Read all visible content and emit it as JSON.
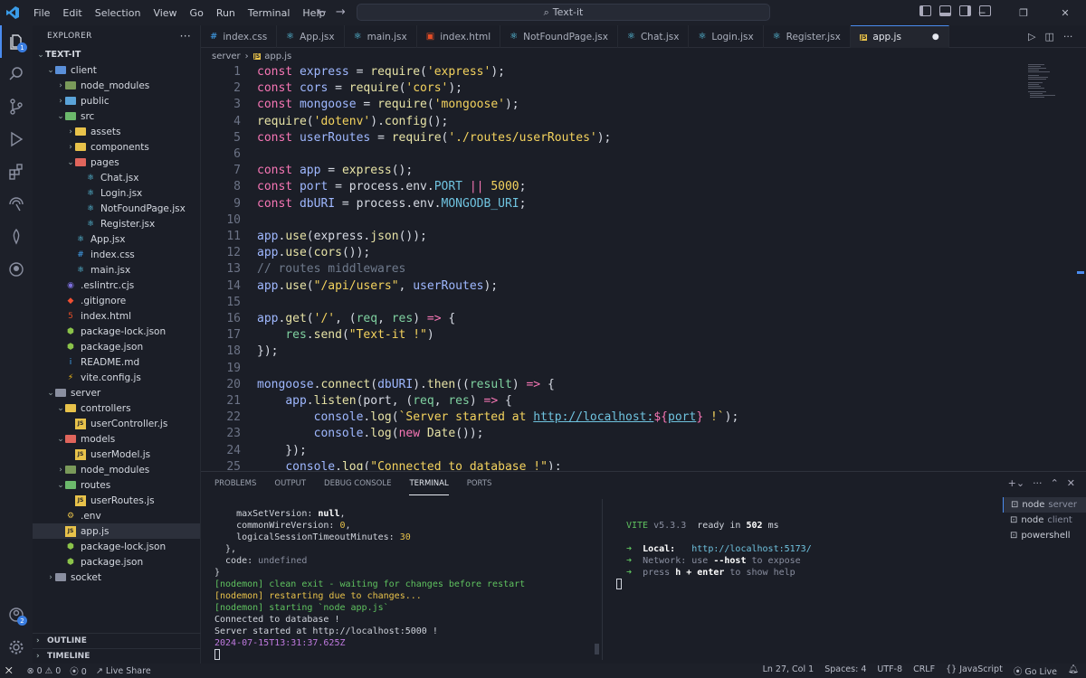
{
  "title_bar": {
    "menus": [
      "File",
      "Edit",
      "Selection",
      "View",
      "Go",
      "Run",
      "Terminal",
      "Help"
    ],
    "search": "Text-it"
  },
  "activity": {
    "explorer_badge": "1",
    "accounts_badge": "2"
  },
  "sidebar": {
    "header": "EXPLORER",
    "root": "TEXT-IT",
    "tree": [
      {
        "label": "client",
        "depth": 1,
        "type": "folder",
        "open": true,
        "color": "#5a8fd8"
      },
      {
        "label": "node_modules",
        "depth": 2,
        "type": "folder",
        "open": false,
        "color": "#7a9a5a"
      },
      {
        "label": "public",
        "depth": 2,
        "type": "folder",
        "open": false,
        "color": "#5aa3d8"
      },
      {
        "label": "src",
        "depth": 2,
        "type": "folder",
        "open": true,
        "color": "#6bb86b"
      },
      {
        "label": "assets",
        "depth": 3,
        "type": "folder",
        "open": false,
        "color": "#e8c24a"
      },
      {
        "label": "components",
        "depth": 3,
        "type": "folder",
        "open": false,
        "color": "#e8c24a"
      },
      {
        "label": "pages",
        "depth": 3,
        "type": "folder",
        "open": true,
        "color": "#e0655c"
      },
      {
        "label": "Chat.jsx",
        "depth": 4,
        "type": "react"
      },
      {
        "label": "Login.jsx",
        "depth": 4,
        "type": "react"
      },
      {
        "label": "NotFoundPage.jsx",
        "depth": 4,
        "type": "react"
      },
      {
        "label": "Register.jsx",
        "depth": 4,
        "type": "react"
      },
      {
        "label": "App.jsx",
        "depth": 3,
        "type": "react"
      },
      {
        "label": "index.css",
        "depth": 3,
        "type": "css"
      },
      {
        "label": "main.jsx",
        "depth": 3,
        "type": "react"
      },
      {
        "label": ".eslintrc.cjs",
        "depth": 2,
        "type": "eslint"
      },
      {
        "label": ".gitignore",
        "depth": 2,
        "type": "git"
      },
      {
        "label": "index.html",
        "depth": 2,
        "type": "html"
      },
      {
        "label": "package-lock.json",
        "depth": 2,
        "type": "npm"
      },
      {
        "label": "package.json",
        "depth": 2,
        "type": "npm"
      },
      {
        "label": "README.md",
        "depth": 2,
        "type": "info"
      },
      {
        "label": "vite.config.js",
        "depth": 2,
        "type": "vite"
      },
      {
        "label": "server",
        "depth": 1,
        "type": "folder",
        "open": true,
        "color": "#8a8fa0"
      },
      {
        "label": "controllers",
        "depth": 2,
        "type": "folder",
        "open": true,
        "color": "#e8c24a"
      },
      {
        "label": "userController.js",
        "depth": 3,
        "type": "js"
      },
      {
        "label": "models",
        "depth": 2,
        "type": "folder",
        "open": true,
        "color": "#e0655c"
      },
      {
        "label": "userModel.js",
        "depth": 3,
        "type": "js"
      },
      {
        "label": "node_modules",
        "depth": 2,
        "type": "folder",
        "open": false,
        "color": "#7a9a5a"
      },
      {
        "label": "routes",
        "depth": 2,
        "type": "folder",
        "open": true,
        "color": "#6bb86b"
      },
      {
        "label": "userRoutes.js",
        "depth": 3,
        "type": "js"
      },
      {
        "label": ".env",
        "depth": 2,
        "type": "env"
      },
      {
        "label": "app.js",
        "depth": 2,
        "type": "js",
        "selected": true
      },
      {
        "label": "package-lock.json",
        "depth": 2,
        "type": "npm"
      },
      {
        "label": "package.json",
        "depth": 2,
        "type": "npm"
      },
      {
        "label": "socket",
        "depth": 1,
        "type": "folder",
        "open": false,
        "color": "#8a8fa0"
      }
    ],
    "outline": "OUTLINE",
    "timeline": "TIMELINE"
  },
  "tabs": [
    {
      "label": "index.css",
      "type": "css"
    },
    {
      "label": "App.jsx",
      "type": "react"
    },
    {
      "label": "main.jsx",
      "type": "react"
    },
    {
      "label": "index.html",
      "type": "html"
    },
    {
      "label": "NotFoundPage.jsx",
      "type": "react"
    },
    {
      "label": "Chat.jsx",
      "type": "react"
    },
    {
      "label": "Login.jsx",
      "type": "react"
    },
    {
      "label": "Register.jsx",
      "type": "react"
    },
    {
      "label": "app.js",
      "type": "js",
      "active": true
    }
  ],
  "breadcrumb": {
    "folder": "server",
    "file": "app.js"
  },
  "code": [
    {
      "n": "1",
      "t": [
        [
          "k",
          "const "
        ],
        [
          "v",
          "express"
        ],
        [
          "p",
          " = "
        ],
        [
          "f",
          "require"
        ],
        [
          "p",
          "("
        ],
        [
          "s",
          "'express'"
        ],
        [
          "p",
          ");"
        ]
      ]
    },
    {
      "n": "2",
      "t": [
        [
          "k",
          "const "
        ],
        [
          "v",
          "cors"
        ],
        [
          "p",
          " = "
        ],
        [
          "f",
          "require"
        ],
        [
          "p",
          "("
        ],
        [
          "s",
          "'cors'"
        ],
        [
          "p",
          ");"
        ]
      ]
    },
    {
      "n": "3",
      "t": [
        [
          "k",
          "const "
        ],
        [
          "v",
          "mongoose"
        ],
        [
          "p",
          " = "
        ],
        [
          "f",
          "require"
        ],
        [
          "p",
          "("
        ],
        [
          "s",
          "'mongoose'"
        ],
        [
          "p",
          ");"
        ]
      ]
    },
    {
      "n": "4",
      "t": [
        [
          "f",
          "require"
        ],
        [
          "p",
          "("
        ],
        [
          "s",
          "'dotenv'"
        ],
        [
          "p",
          ")."
        ],
        [
          "f",
          "config"
        ],
        [
          "p",
          "();"
        ]
      ]
    },
    {
      "n": "5",
      "t": [
        [
          "k",
          "const "
        ],
        [
          "v",
          "userRoutes"
        ],
        [
          "p",
          " = "
        ],
        [
          "f",
          "require"
        ],
        [
          "p",
          "("
        ],
        [
          "s",
          "'./routes/userRoutes'"
        ],
        [
          "p",
          ");"
        ]
      ]
    },
    {
      "n": "6",
      "t": []
    },
    {
      "n": "7",
      "t": [
        [
          "k",
          "const "
        ],
        [
          "v",
          "app"
        ],
        [
          "p",
          " = "
        ],
        [
          "f",
          "express"
        ],
        [
          "p",
          "();"
        ]
      ]
    },
    {
      "n": "8",
      "t": [
        [
          "k",
          "const "
        ],
        [
          "v",
          "port"
        ],
        [
          "p",
          " = process.env."
        ],
        [
          "t",
          "PORT"
        ],
        [
          "p",
          " "
        ],
        [
          "o",
          "||"
        ],
        [
          "p",
          " "
        ],
        [
          "n",
          "5000"
        ],
        [
          "p",
          ";"
        ]
      ]
    },
    {
      "n": "9",
      "t": [
        [
          "k",
          "const "
        ],
        [
          "v",
          "dbURI"
        ],
        [
          "p",
          " = process.env."
        ],
        [
          "t",
          "MONGODB_URI"
        ],
        [
          "p",
          ";"
        ]
      ]
    },
    {
      "n": "10",
      "t": []
    },
    {
      "n": "11",
      "t": [
        [
          "v",
          "app"
        ],
        [
          "p",
          "."
        ],
        [
          "f",
          "use"
        ],
        [
          "p",
          "(express."
        ],
        [
          "f",
          "json"
        ],
        [
          "p",
          "());"
        ]
      ]
    },
    {
      "n": "12",
      "t": [
        [
          "v",
          "app"
        ],
        [
          "p",
          "."
        ],
        [
          "f",
          "use"
        ],
        [
          "p",
          "("
        ],
        [
          "f",
          "cors"
        ],
        [
          "p",
          "());"
        ]
      ]
    },
    {
      "n": "13",
      "t": [
        [
          "c",
          "// routes middlewares"
        ]
      ]
    },
    {
      "n": "14",
      "t": [
        [
          "v",
          "app"
        ],
        [
          "p",
          "."
        ],
        [
          "f",
          "use"
        ],
        [
          "p",
          "("
        ],
        [
          "s",
          "\"/api/users\""
        ],
        [
          "p",
          ", "
        ],
        [
          "v",
          "userRoutes"
        ],
        [
          "p",
          ");"
        ]
      ]
    },
    {
      "n": "15",
      "t": []
    },
    {
      "n": "16",
      "t": [
        [
          "v",
          "app"
        ],
        [
          "p",
          "."
        ],
        [
          "f",
          "get"
        ],
        [
          "p",
          "("
        ],
        [
          "s",
          "'/'"
        ],
        [
          "p",
          ", ("
        ],
        [
          "pp",
          "req"
        ],
        [
          "p",
          ", "
        ],
        [
          "pp",
          "res"
        ],
        [
          "p",
          ") "
        ],
        [
          "k",
          "=>"
        ],
        [
          "p",
          " {"
        ]
      ]
    },
    {
      "n": "17",
      "t": [
        [
          "p",
          "    "
        ],
        [
          "pp",
          "res"
        ],
        [
          "p",
          "."
        ],
        [
          "f",
          "send"
        ],
        [
          "p",
          "("
        ],
        [
          "s",
          "\"Text-it !\""
        ],
        [
          "p",
          ")"
        ]
      ]
    },
    {
      "n": "18",
      "t": [
        [
          "p",
          "});"
        ]
      ]
    },
    {
      "n": "19",
      "t": []
    },
    {
      "n": "20",
      "t": [
        [
          "v",
          "mongoose"
        ],
        [
          "p",
          "."
        ],
        [
          "f",
          "connect"
        ],
        [
          "p",
          "("
        ],
        [
          "v",
          "dbURI"
        ],
        [
          "p",
          ")."
        ],
        [
          "f",
          "then"
        ],
        [
          "p",
          "(("
        ],
        [
          "pp",
          "result"
        ],
        [
          "p",
          ") "
        ],
        [
          "k",
          "=>"
        ],
        [
          "p",
          " {"
        ]
      ]
    },
    {
      "n": "21",
      "t": [
        [
          "p",
          "    "
        ],
        [
          "v",
          "app"
        ],
        [
          "p",
          "."
        ],
        [
          "f",
          "listen"
        ],
        [
          "p",
          "(port, ("
        ],
        [
          "pp",
          "req"
        ],
        [
          "p",
          ", "
        ],
        [
          "pp",
          "res"
        ],
        [
          "p",
          ") "
        ],
        [
          "k",
          "=>"
        ],
        [
          "p",
          " {"
        ]
      ]
    },
    {
      "n": "22",
      "t": [
        [
          "p",
          "        "
        ],
        [
          "v",
          "console"
        ],
        [
          "p",
          "."
        ],
        [
          "f",
          "log"
        ],
        [
          "p",
          "("
        ],
        [
          "s",
          "`Server started at "
        ],
        [
          "u",
          "http://localhost:"
        ],
        [
          "k",
          "${"
        ],
        [
          "u",
          "port"
        ],
        [
          "k",
          "}"
        ],
        [
          "s",
          " !`"
        ],
        [
          "p",
          ");"
        ]
      ]
    },
    {
      "n": "23",
      "t": [
        [
          "p",
          "        "
        ],
        [
          "v",
          "console"
        ],
        [
          "p",
          "."
        ],
        [
          "f",
          "log"
        ],
        [
          "p",
          "("
        ],
        [
          "k",
          "new "
        ],
        [
          "f",
          "Date"
        ],
        [
          "p",
          "());"
        ]
      ]
    },
    {
      "n": "24",
      "t": [
        [
          "p",
          "    });"
        ]
      ]
    },
    {
      "n": "25",
      "t": [
        [
          "p",
          "    "
        ],
        [
          "v",
          "console"
        ],
        [
          "p",
          "."
        ],
        [
          "f",
          "log"
        ],
        [
          "p",
          "("
        ],
        [
          "s",
          "\"Connected to database !\""
        ],
        [
          "p",
          ");"
        ]
      ]
    }
  ],
  "panel": {
    "tabs": [
      "PROBLEMS",
      "OUTPUT",
      "DEBUG CONSOLE",
      "TERMINAL",
      "PORTS"
    ],
    "active_tab": "TERMINAL",
    "left_lines": [
      {
        "t": [
          [
            "p",
            "    maxSetVersion: "
          ],
          [
            "b",
            "null"
          ],
          [
            "p",
            ","
          ]
        ]
      },
      {
        "t": [
          [
            "p",
            "    commonWireVersion: "
          ],
          [
            "y",
            "0"
          ],
          [
            "p",
            ","
          ]
        ]
      },
      {
        "t": [
          [
            "p",
            "    logicalSessionTimeoutMinutes: "
          ],
          [
            "y",
            "30"
          ]
        ]
      },
      {
        "t": [
          [
            "p",
            "  },"
          ]
        ]
      },
      {
        "t": [
          [
            "p",
            "  code: "
          ],
          [
            "g",
            "undefined"
          ]
        ]
      },
      {
        "t": [
          [
            "p",
            "}"
          ]
        ]
      },
      {
        "t": [
          [
            "gr",
            "[nodemon] clean exit - waiting for changes before restart"
          ]
        ]
      },
      {
        "t": [
          [
            "y",
            "[nodemon] restarting due to changes..."
          ]
        ]
      },
      {
        "t": [
          [
            "gr",
            "[nodemon] starting `node app.js`"
          ]
        ]
      },
      {
        "t": [
          [
            "p",
            "Connected to database !"
          ]
        ]
      },
      {
        "t": [
          [
            "p",
            "Server started at http://localhost:5000 !"
          ]
        ]
      },
      {
        "t": [
          [
            "m",
            "2024-07-15T13:31:37.625Z"
          ]
        ]
      }
    ],
    "right_lines": [
      {
        "t": [
          [
            "gr",
            "VITE"
          ],
          [
            "g",
            " v5.3.3"
          ],
          [
            "p",
            "  ready in "
          ],
          [
            "b",
            "502"
          ],
          [
            "p",
            " ms"
          ]
        ]
      },
      {
        "t": []
      },
      {
        "t": [
          [
            "gr",
            "➜ "
          ],
          [
            "b",
            " Local:"
          ],
          [
            "p",
            "   "
          ],
          [
            "cy",
            "http://localhost:5173/"
          ]
        ]
      },
      {
        "t": [
          [
            "gr",
            "➜ "
          ],
          [
            "g",
            " Network: use "
          ],
          [
            "b",
            "--host"
          ],
          [
            "g",
            " to expose"
          ]
        ]
      },
      {
        "t": [
          [
            "gr",
            "➜ "
          ],
          [
            "g",
            " press "
          ],
          [
            "b",
            "h + enter"
          ],
          [
            "g",
            " to show help"
          ]
        ]
      }
    ],
    "terminals": [
      {
        "name": "node",
        "tag": "server",
        "selected": true
      },
      {
        "name": "node",
        "tag": "client"
      },
      {
        "name": "powershell",
        "tag": ""
      }
    ]
  },
  "status": {
    "errors": "0",
    "warnings": "0",
    "ports": "0",
    "live_share": "Live Share",
    "position": "Ln 27, Col 1",
    "spaces": "Spaces: 4",
    "encoding": "UTF-8",
    "eol": "CRLF",
    "language": "JavaScript",
    "go_live": "Go Live"
  }
}
